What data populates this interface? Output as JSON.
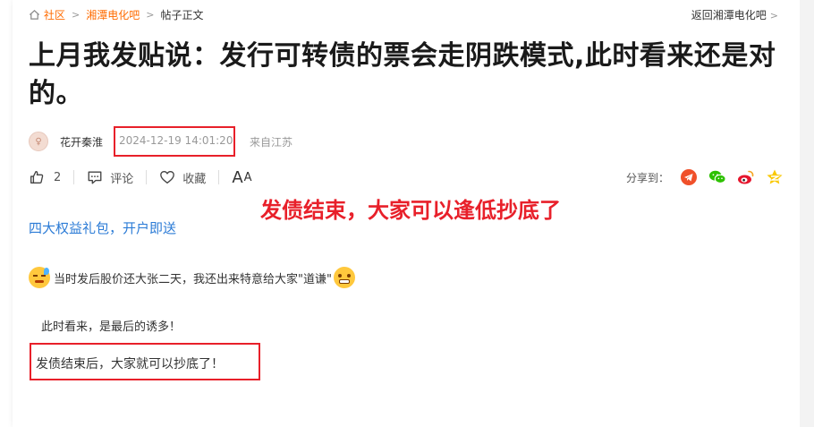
{
  "breadcrumb": {
    "home": "社区",
    "forum": "湘潭电化吧",
    "current": "帖子正文"
  },
  "back_link": "返回湘潭电化吧",
  "post": {
    "title": "上月我发贴说：发行可转债的票会走阴跌模式,此时看来还是对的。",
    "author": "花开秦淮",
    "time": "2024-12-19 14:01:20",
    "location": "来自江苏",
    "likes": "2",
    "comment_label": "评论",
    "favorite_label": "收藏",
    "font_big": "A",
    "font_small": "A",
    "share_label": "分享到：",
    "promo": "四大权益礼包，开户即送",
    "body": [
      "当时发后股价还大张二天，我还出来特意给大家\"道谦\"",
      "此时看来，是最后的诱多！",
      "发债结束后，大家就可以抄底了！"
    ]
  },
  "annotation": "发债结束，大家可以逢低抄底了",
  "colors": {
    "accent": "#ff6b00",
    "link": "#2b7bd6",
    "annotation": "#e8202a"
  },
  "icons": [
    "home-icon",
    "like-icon",
    "comment-icon",
    "heart-icon",
    "telegram-icon",
    "wechat-icon",
    "weibo-icon",
    "qzone-icon",
    "sweat-emoji-icon",
    "grimace-emoji-icon"
  ]
}
